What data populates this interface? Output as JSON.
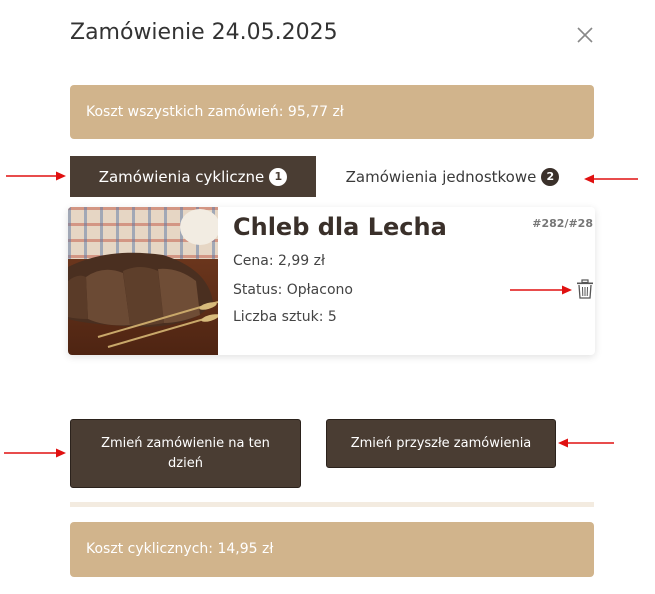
{
  "modal": {
    "title": "Zamówienie 24.05.2025",
    "close_icon": "close-icon"
  },
  "summary": {
    "total_label": "Koszt wszystkich zamówień: 95,77 zł",
    "cyclic_label": "Koszt cyklicznych: 14,95 zł"
  },
  "tabs": [
    {
      "label": "Zamówienia cykliczne",
      "count": "1",
      "active": true
    },
    {
      "label": "Zamówienia jednostkowe",
      "count": "2",
      "active": false
    }
  ],
  "order_card": {
    "product_name": "Chleb dla Lecha",
    "order_id": "#282/#28",
    "price": "Cena: 2,99 zł",
    "status": "Status: Opłacono",
    "quantity": "Liczba sztuk: 5",
    "image_icon": "bread-photo",
    "delete_icon": "trash-icon"
  },
  "actions": {
    "change_day": "Zmień zamówienie na ten dzień",
    "change_future": "Zmień przyszłe zamówienia"
  },
  "colors": {
    "accent_tan": "#d1b48c",
    "dark_brown": "#4a3d33",
    "annotation_red": "#e01010",
    "divider": "#f3ebe0"
  }
}
